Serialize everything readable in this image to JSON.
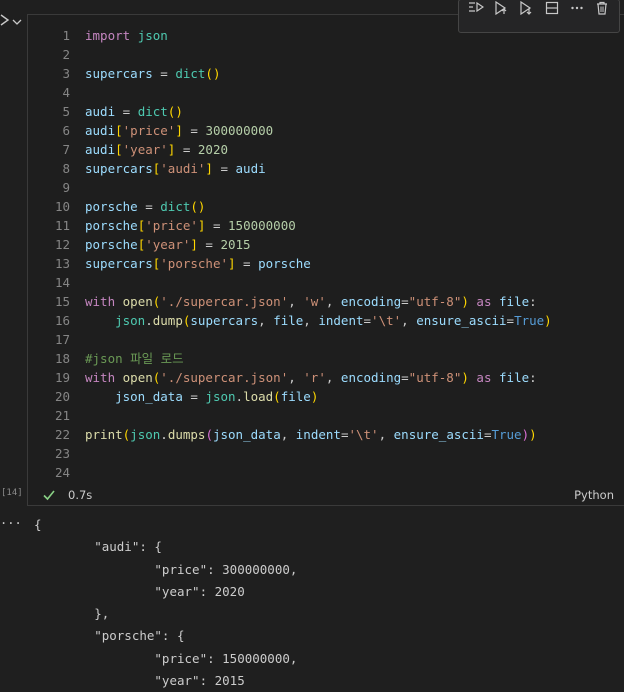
{
  "cell": {
    "execution_count": "[14]",
    "status_time": "0.7s",
    "language": "Python",
    "toolbar": [
      {
        "name": "run-by-line-icon"
      },
      {
        "name": "execute-above-icon"
      },
      {
        "name": "execute-below-icon"
      },
      {
        "name": "split-cell-icon"
      },
      {
        "name": "more-actions-icon"
      },
      {
        "name": "delete-cell-icon"
      }
    ],
    "lines": [
      {
        "n": "1",
        "tokens": [
          {
            "t": "import",
            "c": "kw-import"
          },
          {
            "t": " ",
            "c": "plain"
          },
          {
            "t": "json",
            "c": "builtin"
          }
        ]
      },
      {
        "n": "2",
        "tokens": []
      },
      {
        "n": "3",
        "tokens": [
          {
            "t": "supercars",
            "c": "var"
          },
          {
            "t": " = ",
            "c": "plain"
          },
          {
            "t": "dict",
            "c": "builtin"
          },
          {
            "t": "()",
            "c": "br1"
          }
        ]
      },
      {
        "n": "4",
        "tokens": []
      },
      {
        "n": "5",
        "tokens": [
          {
            "t": "audi",
            "c": "var"
          },
          {
            "t": " = ",
            "c": "plain"
          },
          {
            "t": "dict",
            "c": "builtin"
          },
          {
            "t": "()",
            "c": "br1"
          }
        ]
      },
      {
        "n": "6",
        "tokens": [
          {
            "t": "audi",
            "c": "var"
          },
          {
            "t": "[",
            "c": "br1"
          },
          {
            "t": "'price'",
            "c": "str"
          },
          {
            "t": "]",
            "c": "br1"
          },
          {
            "t": " = ",
            "c": "plain"
          },
          {
            "t": "300000000",
            "c": "num"
          }
        ]
      },
      {
        "n": "7",
        "tokens": [
          {
            "t": "audi",
            "c": "var"
          },
          {
            "t": "[",
            "c": "br1"
          },
          {
            "t": "'year'",
            "c": "str"
          },
          {
            "t": "]",
            "c": "br1"
          },
          {
            "t": " = ",
            "c": "plain"
          },
          {
            "t": "2020",
            "c": "num"
          }
        ]
      },
      {
        "n": "8",
        "tokens": [
          {
            "t": "supercars",
            "c": "var"
          },
          {
            "t": "[",
            "c": "br1"
          },
          {
            "t": "'audi'",
            "c": "str"
          },
          {
            "t": "]",
            "c": "br1"
          },
          {
            "t": " = ",
            "c": "plain"
          },
          {
            "t": "audi",
            "c": "var"
          }
        ]
      },
      {
        "n": "9",
        "tokens": []
      },
      {
        "n": "10",
        "tokens": [
          {
            "t": "porsche",
            "c": "var"
          },
          {
            "t": " = ",
            "c": "plain"
          },
          {
            "t": "dict",
            "c": "builtin"
          },
          {
            "t": "()",
            "c": "br1"
          }
        ]
      },
      {
        "n": "11",
        "tokens": [
          {
            "t": "porsche",
            "c": "var"
          },
          {
            "t": "[",
            "c": "br1"
          },
          {
            "t": "'price'",
            "c": "str"
          },
          {
            "t": "]",
            "c": "br1"
          },
          {
            "t": " = ",
            "c": "plain"
          },
          {
            "t": "150000000",
            "c": "num"
          }
        ]
      },
      {
        "n": "12",
        "tokens": [
          {
            "t": "porsche",
            "c": "var"
          },
          {
            "t": "[",
            "c": "br1"
          },
          {
            "t": "'year'",
            "c": "str"
          },
          {
            "t": "]",
            "c": "br1"
          },
          {
            "t": " = ",
            "c": "plain"
          },
          {
            "t": "2015",
            "c": "num"
          }
        ]
      },
      {
        "n": "13",
        "tokens": [
          {
            "t": "supercars",
            "c": "var"
          },
          {
            "t": "[",
            "c": "br1"
          },
          {
            "t": "'porsche'",
            "c": "str"
          },
          {
            "t": "]",
            "c": "br1"
          },
          {
            "t": " = ",
            "c": "plain"
          },
          {
            "t": "porsche",
            "c": "var"
          }
        ]
      },
      {
        "n": "14",
        "tokens": []
      },
      {
        "n": "15",
        "tokens": [
          {
            "t": "with",
            "c": "kw-flow"
          },
          {
            "t": " ",
            "c": "plain"
          },
          {
            "t": "open",
            "c": "fn"
          },
          {
            "t": "(",
            "c": "br1"
          },
          {
            "t": "'./supercar.json'",
            "c": "str"
          },
          {
            "t": ", ",
            "c": "plain"
          },
          {
            "t": "'w'",
            "c": "str"
          },
          {
            "t": ", ",
            "c": "plain"
          },
          {
            "t": "encoding",
            "c": "var"
          },
          {
            "t": "=",
            "c": "plain"
          },
          {
            "t": "\"utf-8\"",
            "c": "str"
          },
          {
            "t": ")",
            "c": "br1"
          },
          {
            "t": " ",
            "c": "plain"
          },
          {
            "t": "as",
            "c": "kw-flow"
          },
          {
            "t": " ",
            "c": "plain"
          },
          {
            "t": "file",
            "c": "var"
          },
          {
            "t": ":",
            "c": "plain"
          }
        ]
      },
      {
        "n": "16",
        "tokens": [
          {
            "t": "    ",
            "c": "plain"
          },
          {
            "t": "json",
            "c": "builtin"
          },
          {
            "t": ".",
            "c": "plain"
          },
          {
            "t": "dump",
            "c": "fn"
          },
          {
            "t": "(",
            "c": "br1"
          },
          {
            "t": "supercars",
            "c": "var"
          },
          {
            "t": ", ",
            "c": "plain"
          },
          {
            "t": "file",
            "c": "var"
          },
          {
            "t": ", ",
            "c": "plain"
          },
          {
            "t": "indent",
            "c": "var"
          },
          {
            "t": "=",
            "c": "plain"
          },
          {
            "t": "'\\t'",
            "c": "str"
          },
          {
            "t": ", ",
            "c": "plain"
          },
          {
            "t": "ensure_ascii",
            "c": "var"
          },
          {
            "t": "=",
            "c": "plain"
          },
          {
            "t": "True",
            "c": "bool"
          },
          {
            "t": ")",
            "c": "br1"
          }
        ]
      },
      {
        "n": "17",
        "tokens": []
      },
      {
        "n": "18",
        "tokens": [
          {
            "t": "#json 파일 로드",
            "c": "cmt"
          }
        ]
      },
      {
        "n": "19",
        "tokens": [
          {
            "t": "with",
            "c": "kw-flow"
          },
          {
            "t": " ",
            "c": "plain"
          },
          {
            "t": "open",
            "c": "fn"
          },
          {
            "t": "(",
            "c": "br1"
          },
          {
            "t": "'./supercar.json'",
            "c": "str"
          },
          {
            "t": ", ",
            "c": "plain"
          },
          {
            "t": "'r'",
            "c": "str"
          },
          {
            "t": ", ",
            "c": "plain"
          },
          {
            "t": "encoding",
            "c": "var"
          },
          {
            "t": "=",
            "c": "plain"
          },
          {
            "t": "\"utf-8\"",
            "c": "str"
          },
          {
            "t": ")",
            "c": "br1"
          },
          {
            "t": " ",
            "c": "plain"
          },
          {
            "t": "as",
            "c": "kw-flow"
          },
          {
            "t": " ",
            "c": "plain"
          },
          {
            "t": "file",
            "c": "var"
          },
          {
            "t": ":",
            "c": "plain"
          }
        ]
      },
      {
        "n": "20",
        "tokens": [
          {
            "t": "    ",
            "c": "plain"
          },
          {
            "t": "json_data",
            "c": "var"
          },
          {
            "t": " = ",
            "c": "plain"
          },
          {
            "t": "json",
            "c": "builtin"
          },
          {
            "t": ".",
            "c": "plain"
          },
          {
            "t": "load",
            "c": "fn"
          },
          {
            "t": "(",
            "c": "br1"
          },
          {
            "t": "file",
            "c": "var"
          },
          {
            "t": ")",
            "c": "br1"
          }
        ]
      },
      {
        "n": "21",
        "tokens": []
      },
      {
        "n": "22",
        "tokens": [
          {
            "t": "print",
            "c": "fn"
          },
          {
            "t": "(",
            "c": "br1"
          },
          {
            "t": "json",
            "c": "builtin"
          },
          {
            "t": ".",
            "c": "plain"
          },
          {
            "t": "dumps",
            "c": "fn"
          },
          {
            "t": "(",
            "c": "br2"
          },
          {
            "t": "json_data",
            "c": "var"
          },
          {
            "t": ", ",
            "c": "plain"
          },
          {
            "t": "indent",
            "c": "var"
          },
          {
            "t": "=",
            "c": "plain"
          },
          {
            "t": "'\\t'",
            "c": "str"
          },
          {
            "t": ", ",
            "c": "plain"
          },
          {
            "t": "ensure_ascii",
            "c": "var"
          },
          {
            "t": "=",
            "c": "plain"
          },
          {
            "t": "True",
            "c": "bool"
          },
          {
            "t": ")",
            "c": "br2"
          },
          {
            "t": ")",
            "c": "br1"
          }
        ]
      },
      {
        "n": "23",
        "tokens": []
      },
      {
        "n": "24",
        "tokens": []
      }
    ]
  },
  "output": {
    "more_label": "...",
    "lines": [
      "{",
      "        \"audi\": {",
      "                \"price\": 300000000,",
      "                \"year\": 2020",
      "        },",
      "        \"porsche\": {",
      "                \"price\": 150000000,",
      "                \"year\": 2015"
    ]
  },
  "colors": {
    "background": "#1f1f1f",
    "cell_background": "#1e1e1e",
    "success_check": "#89d185"
  }
}
